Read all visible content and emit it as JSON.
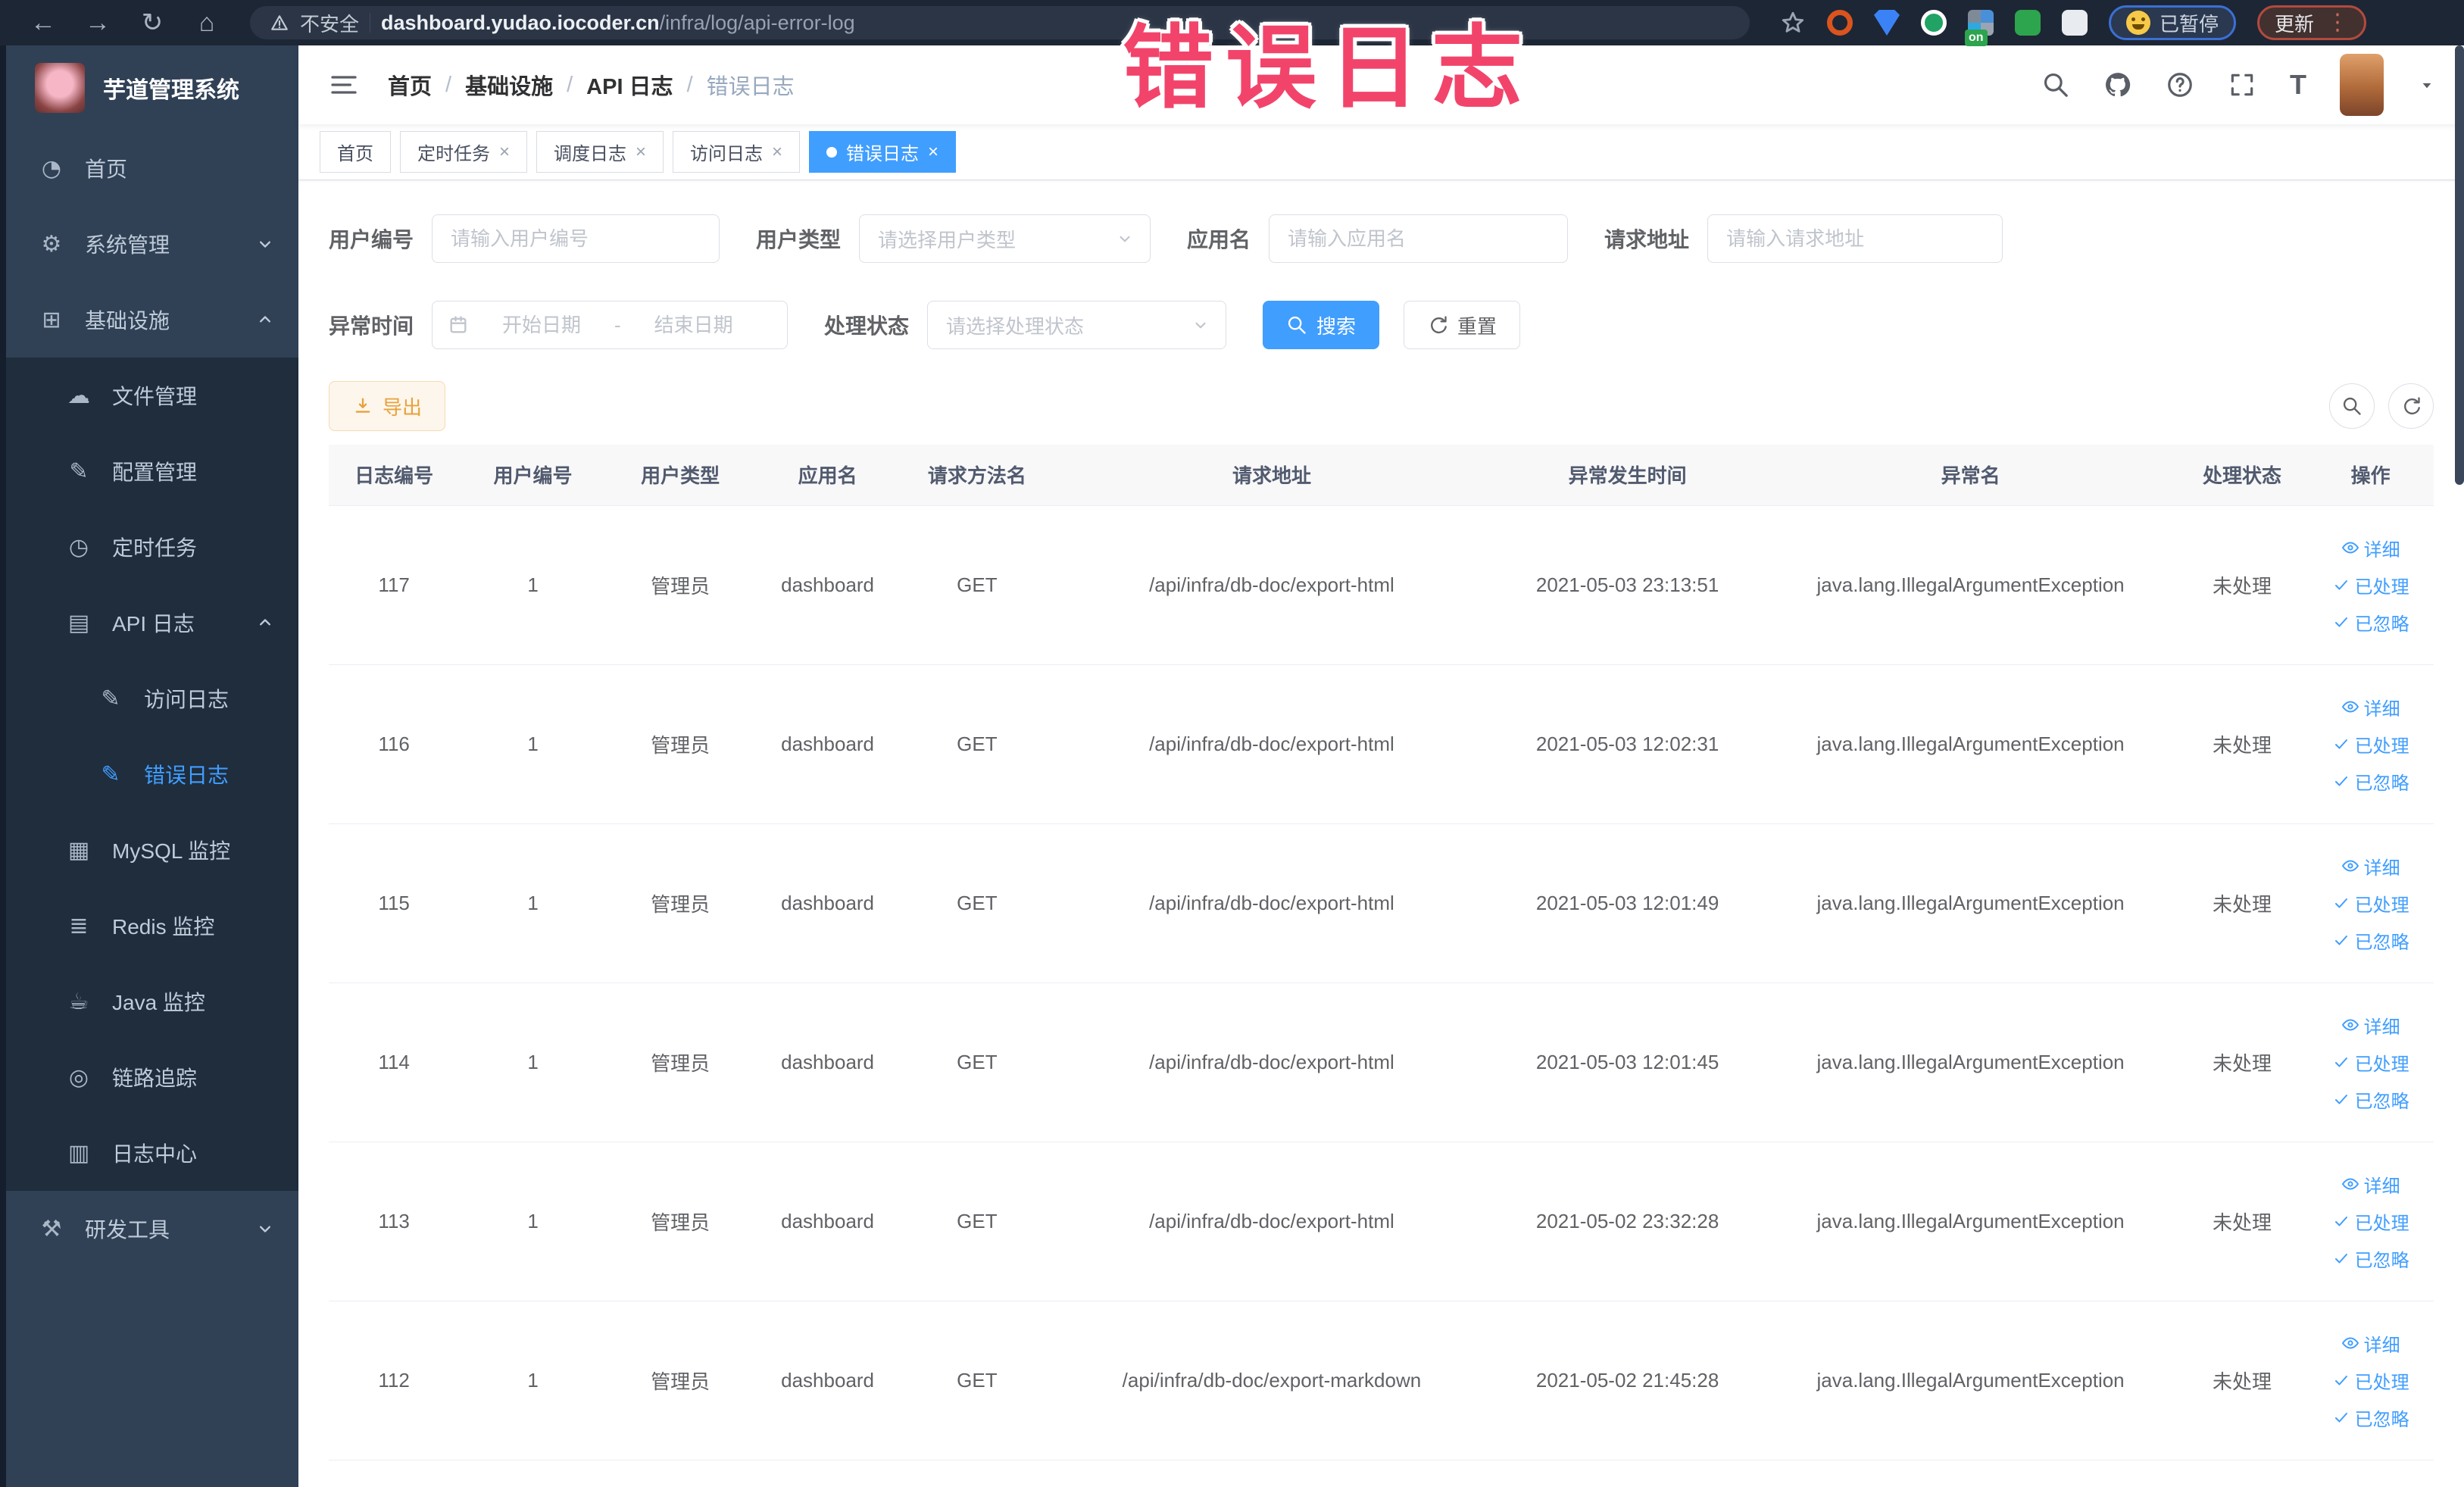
{
  "overlay": {
    "title": "错误日志"
  },
  "browser": {
    "security_label": "不安全",
    "url_host": "dashboard.yudao.iocoder.cn",
    "url_path": "/infra/log/api-error-log",
    "paused_label": "已暂停",
    "update_label": "更新",
    "badge_on": "on"
  },
  "icons": {
    "back-icon": "←",
    "forward-icon": "→",
    "reload-icon": "↻",
    "home-icon": "⌂",
    "menu-dots-icon": "⋮",
    "font-size-icon": "T",
    "dashboard-icon": "◔",
    "gear-icon": "⚙",
    "infra-icon": "⊞",
    "file-icon": "☁",
    "config-icon": "✎",
    "timer-icon": "◷",
    "api-log-icon": "▤",
    "access-log-icon": "✎",
    "error-log-icon": "✎",
    "mysql-icon": "▦",
    "redis-icon": "≣",
    "java-icon": "☕",
    "trace-icon": "◎",
    "log-center-icon": "▥",
    "devtools-icon": "⚒"
  },
  "sidebar": {
    "app_title": "芋道管理系统",
    "items": [
      {
        "label": "首页",
        "icon": "dashboard-icon",
        "level": 0
      },
      {
        "label": "系统管理",
        "icon": "gear-icon",
        "level": 0,
        "arrow": "down"
      },
      {
        "label": "基础设施",
        "icon": "infra-icon",
        "level": 0,
        "arrow": "up"
      },
      {
        "label": "文件管理",
        "icon": "file-icon",
        "level": 1,
        "group": true
      },
      {
        "label": "配置管理",
        "icon": "config-icon",
        "level": 1,
        "group": true
      },
      {
        "label": "定时任务",
        "icon": "timer-icon",
        "level": 1,
        "group": true
      },
      {
        "label": "API 日志",
        "icon": "api-log-icon",
        "level": 1,
        "group": true,
        "arrow": "up"
      },
      {
        "label": "访问日志",
        "icon": "access-log-icon",
        "level": 2,
        "group": true
      },
      {
        "label": "错误日志",
        "icon": "error-log-icon",
        "level": 2,
        "group": true,
        "active": true
      },
      {
        "label": "MySQL 监控",
        "icon": "mysql-icon",
        "level": 1,
        "group": true
      },
      {
        "label": "Redis 监控",
        "icon": "redis-icon",
        "level": 1,
        "group": true
      },
      {
        "label": "Java 监控",
        "icon": "java-icon",
        "level": 1,
        "group": true
      },
      {
        "label": "链路追踪",
        "icon": "trace-icon",
        "level": 1,
        "group": true
      },
      {
        "label": "日志中心",
        "icon": "log-center-icon",
        "level": 1,
        "group": true
      },
      {
        "label": "研发工具",
        "icon": "devtools-icon",
        "level": 0,
        "arrow": "down"
      }
    ]
  },
  "header": {
    "breadcrumb": [
      "首页",
      "基础设施",
      "API 日志",
      "错误日志"
    ],
    "breadcrumb_separator": "/"
  },
  "tabs": [
    {
      "label": "首页",
      "closable": false,
      "active": false
    },
    {
      "label": "定时任务",
      "closable": true,
      "active": false
    },
    {
      "label": "调度日志",
      "closable": true,
      "active": false
    },
    {
      "label": "访问日志",
      "closable": true,
      "active": false
    },
    {
      "label": "错误日志",
      "closable": true,
      "active": true
    }
  ],
  "filters": {
    "user_id": {
      "label": "用户编号",
      "placeholder": "请输入用户编号"
    },
    "user_type": {
      "label": "用户类型",
      "placeholder": "请选择用户类型"
    },
    "app_name": {
      "label": "应用名",
      "placeholder": "请输入应用名"
    },
    "request_url": {
      "label": "请求地址",
      "placeholder": "请输入请求地址"
    },
    "exception_time": {
      "label": "异常时间",
      "start_placeholder": "开始日期",
      "separator": "-",
      "end_placeholder": "结束日期"
    },
    "process_status": {
      "label": "处理状态",
      "placeholder": "请选择处理状态"
    },
    "search_label": "搜索",
    "reset_label": "重置"
  },
  "toolbar": {
    "export_label": "导出"
  },
  "table": {
    "columns": [
      "日志编号",
      "用户编号",
      "用户类型",
      "应用名",
      "请求方法名",
      "请求地址",
      "异常发生时间",
      "异常名",
      "处理状态",
      "操作"
    ],
    "action_labels": [
      "详细",
      "已处理",
      "已忽略"
    ],
    "rows": [
      {
        "id": "117",
        "user_id": "1",
        "user_type": "管理员",
        "app": "dashboard",
        "method": "GET",
        "url": "/api/infra/db-doc/export-html",
        "time": "2021-05-03 23:13:51",
        "exception": "java.lang.IllegalArgumentException",
        "status": "未处理"
      },
      {
        "id": "116",
        "user_id": "1",
        "user_type": "管理员",
        "app": "dashboard",
        "method": "GET",
        "url": "/api/infra/db-doc/export-html",
        "time": "2021-05-03 12:02:31",
        "exception": "java.lang.IllegalArgumentException",
        "status": "未处理"
      },
      {
        "id": "115",
        "user_id": "1",
        "user_type": "管理员",
        "app": "dashboard",
        "method": "GET",
        "url": "/api/infra/db-doc/export-html",
        "time": "2021-05-03 12:01:49",
        "exception": "java.lang.IllegalArgumentException",
        "status": "未处理"
      },
      {
        "id": "114",
        "user_id": "1",
        "user_type": "管理员",
        "app": "dashboard",
        "method": "GET",
        "url": "/api/infra/db-doc/export-html",
        "time": "2021-05-03 12:01:45",
        "exception": "java.lang.IllegalArgumentException",
        "status": "未处理"
      },
      {
        "id": "113",
        "user_id": "1",
        "user_type": "管理员",
        "app": "dashboard",
        "method": "GET",
        "url": "/api/infra/db-doc/export-html",
        "time": "2021-05-02 23:32:28",
        "exception": "java.lang.IllegalArgumentException",
        "status": "未处理"
      },
      {
        "id": "112",
        "user_id": "1",
        "user_type": "管理员",
        "app": "dashboard",
        "method": "GET",
        "url": "/api/infra/db-doc/export-markdown",
        "time": "2021-05-02 21:45:28",
        "exception": "java.lang.IllegalArgumentException",
        "status": "未处理"
      }
    ]
  },
  "colors": {
    "primary": "#409eff",
    "warning": "#e6a23c",
    "sidebar_bg": "#304156",
    "submenu_bg": "#1f2d3d",
    "overlay_pink": "#f2446b"
  }
}
